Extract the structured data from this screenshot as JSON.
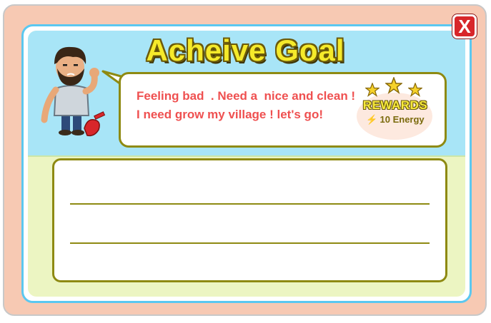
{
  "dialog": {
    "title": "Acheive Goal",
    "close_label": "X"
  },
  "message": {
    "line1": "Feeling bad  . Need a  nice and clean !",
    "line2": "I need grow my village ! let's go!"
  },
  "rewards": {
    "label": "REWARDS",
    "energy": "10 Energy",
    "icon": "lightning-icon",
    "stars": 3
  },
  "colors": {
    "title_fill": "#f5ea2a",
    "message_text": "#ef5050",
    "sky": "#a8e5f7",
    "panel_border": "#8e8a12"
  }
}
